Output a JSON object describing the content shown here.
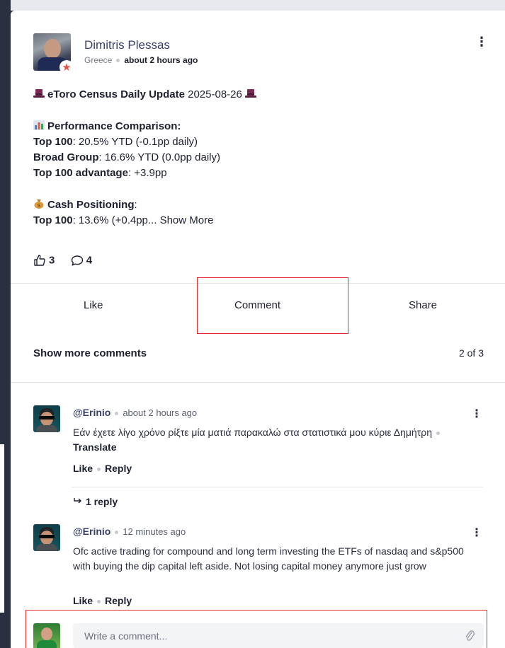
{
  "post": {
    "author": "Dimitris Plessas",
    "country": "Greece",
    "time": "about 2 hours ago",
    "title_bold": "eToro Census Daily Update",
    "title_date": "2025-08-26",
    "perf_heading": "Performance Comparison:",
    "top100_label": "Top 100",
    "top100_value": ": 20.5% YTD (-0.1pp daily)",
    "broad_label": "Broad Group",
    "broad_value": ": 16.6% YTD (0.0pp daily)",
    "advantage_label": "Top 100 advantage",
    "advantage_value": ": +3.9pp",
    "cash_heading": "Cash Positioning",
    "cash_colon": ":",
    "cash_top100_label": "Top 100",
    "cash_top100_value": ": 13.6% (+0.4pp...",
    "show_more": "Show More",
    "likes": "3",
    "comments": "4"
  },
  "actions": {
    "like": "Like",
    "comment": "Comment",
    "share": "Share"
  },
  "comments_section": {
    "show_more": "Show more comments",
    "count": "2 of 3",
    "items": [
      {
        "author": "@Erinio",
        "time": "about 2 hours ago",
        "text": "Εάν έχετε λίγο χρόνο ρίξτε μία ματιά παρακαλώ στα στατιστικά μου κύριε Δημήτρη",
        "translate": "Translate",
        "like": "Like",
        "reply": "Reply"
      },
      {
        "author": "@Erinio",
        "time": "12 minutes ago",
        "text": "Ofc active trading for compound and long term investing the ETFs of nasdaq and s&p500 with buying the dip capital left aside. Not losing capital money anymore just grow",
        "like": "Like",
        "reply": "Reply"
      }
    ],
    "reply_link": "1 reply"
  },
  "composer": {
    "placeholder": "Write a comment..."
  },
  "icons": {
    "more": "kebab-menu-icon",
    "star": "star-badge-icon",
    "hat": "top-hat-icon",
    "chart": "bar-chart-icon",
    "money": "money-bag-icon",
    "like": "thumbs-up-icon",
    "comment": "speech-bubble-icon",
    "reply": "reply-arrow-icon",
    "attach": "paperclip-icon"
  },
  "colors": {
    "highlight": "#e42b2b",
    "author": "#3a3f6b",
    "background": "#2b3041"
  }
}
